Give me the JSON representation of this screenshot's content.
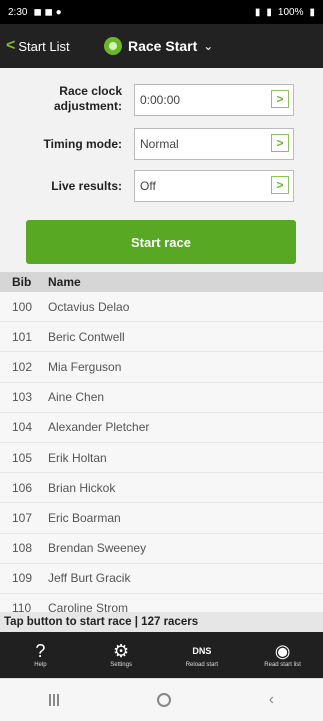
{
  "status_bar": {
    "time": "2:30",
    "battery": "100%"
  },
  "app_bar": {
    "back_label": "Start List",
    "title": "Race Start"
  },
  "settings": {
    "race_clock_label": "Race clock adjustment:",
    "race_clock_value": "0:00:00",
    "timing_mode_label": "Timing mode:",
    "timing_mode_value": "Normal",
    "live_results_label": "Live results:",
    "live_results_value": "Off",
    "start_button": "Start race"
  },
  "list_header": {
    "bib": "Bib",
    "name": "Name"
  },
  "racers": [
    {
      "bib": "100",
      "name": "Octavius Delao"
    },
    {
      "bib": "101",
      "name": "Beric Contwell"
    },
    {
      "bib": "102",
      "name": "Mia Ferguson"
    },
    {
      "bib": "103",
      "name": "Aine Chen"
    },
    {
      "bib": "104",
      "name": "Alexander Pletcher"
    },
    {
      "bib": "105",
      "name": "Erik Holtan"
    },
    {
      "bib": "106",
      "name": "Brian Hickok"
    },
    {
      "bib": "107",
      "name": "Eric Boarman"
    },
    {
      "bib": "108",
      "name": "Brendan Sweeney"
    },
    {
      "bib": "109",
      "name": "Jeff Burt Gracik"
    },
    {
      "bib": "110",
      "name": "Caroline Strom"
    }
  ],
  "status_line": "Tap button to start race | 127 racers",
  "toolbar": [
    {
      "label": "Help",
      "icon": "help-icon"
    },
    {
      "label": "Settings",
      "icon": "settings-icon"
    },
    {
      "label": "Reload start",
      "icon": "dns-icon"
    },
    {
      "label": "Read start list",
      "icon": "wireless-icon"
    }
  ],
  "colors": {
    "accent": "#58a824",
    "app_bar": "#222222"
  }
}
